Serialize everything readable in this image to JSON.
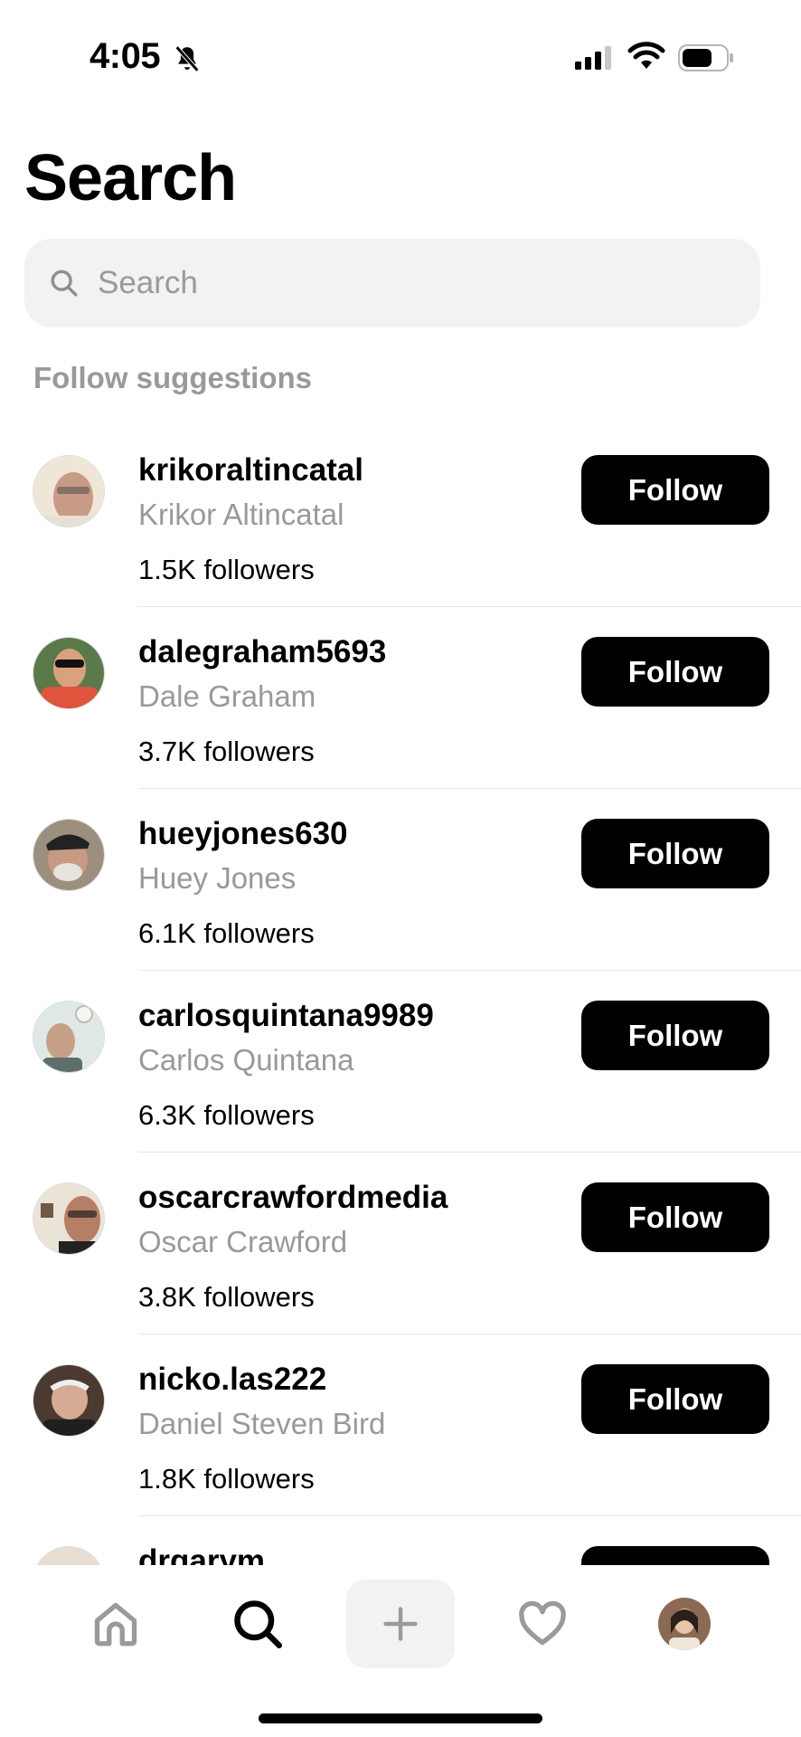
{
  "status_bar": {
    "time": "4:05",
    "icons": [
      "bell-slash-icon",
      "cellular-signal-icon",
      "wifi-icon",
      "battery-icon"
    ]
  },
  "page": {
    "title": "Search"
  },
  "search": {
    "placeholder": "Search",
    "value": ""
  },
  "suggestions": {
    "section_label": "Follow suggestions",
    "follow_label": "Follow",
    "items": [
      {
        "username": "krikoraltincatal",
        "name": "Krikor Altincatal",
        "followers": "1.5K followers"
      },
      {
        "username": "dalegraham5693",
        "name": "Dale Graham",
        "followers": "3.7K followers"
      },
      {
        "username": "hueyjones630",
        "name": "Huey Jones",
        "followers": "6.1K followers"
      },
      {
        "username": "carlosquintana9989",
        "name": "Carlos Quintana",
        "followers": "6.3K followers"
      },
      {
        "username": "oscarcrawfordmedia",
        "name": "Oscar Crawford",
        "followers": "3.8K followers"
      },
      {
        "username": "nicko.las222",
        "name": "Daniel Steven Bird",
        "followers": "1.8K followers"
      },
      {
        "username": "drgarym",
        "name": "",
        "followers": ""
      }
    ]
  },
  "nav": {
    "items": [
      "home-icon",
      "search-icon",
      "plus-icon",
      "heart-icon",
      "profile-avatar"
    ],
    "active": "search-icon"
  },
  "colors": {
    "accent": "#000000",
    "muted_text": "#999999",
    "search_bg": "#f2f2f2"
  }
}
